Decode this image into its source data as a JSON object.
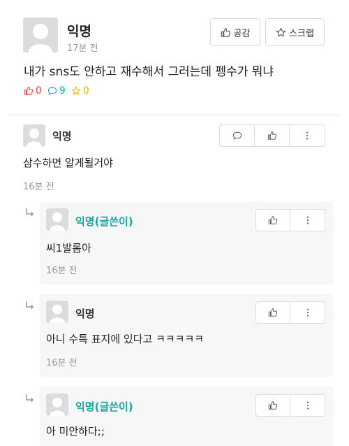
{
  "post": {
    "author": "익명",
    "time": "17분 전",
    "like_label": "공감",
    "scrap_label": "스크랩",
    "body": "내가 sns도 안하고 재수해서 그러는데 펭수가 뭐냐",
    "stats": {
      "likes": "0",
      "comments": "9",
      "scraps": "0"
    }
  },
  "comments": [
    {
      "author": "익명",
      "body": "삼수하면 알게될거야",
      "time": "16분 전"
    }
  ],
  "replies": [
    {
      "author": "익명(글쓴이)",
      "body": "씨1발롬아",
      "time": "16분 전"
    },
    {
      "author": "익명",
      "body": "아니 수특 표지에 있다고 ㅋㅋㅋㅋㅋ",
      "time": "16분 전"
    },
    {
      "author": "익명(글쓴이)",
      "body": "아 미안하다;;",
      "time": ""
    }
  ],
  "colors": {
    "author_highlight": "#18a3a0",
    "like": "#e0433a",
    "comment": "#2aa0c4",
    "scrap": "#e9b400"
  }
}
